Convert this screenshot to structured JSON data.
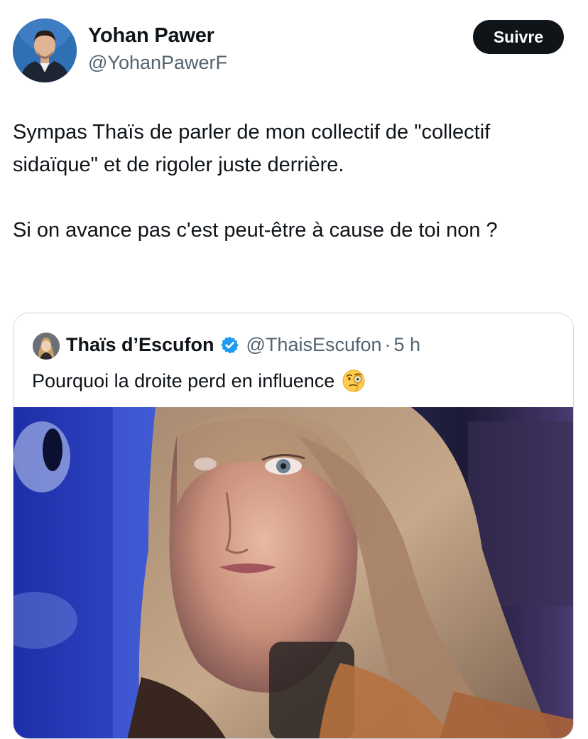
{
  "tweet": {
    "author": {
      "name": "Yohan Pawer",
      "handle": "@YohanPawerF"
    },
    "follow_label": "Suivre",
    "paragraphs": [
      "Sympas Thaïs de parler de mon collectif de \"collectif sidaïque\" et de rigoler juste derrière.",
      "Si on avance pas c'est peut-être à cause de toi non ?"
    ]
  },
  "quote": {
    "author": {
      "name": "Thaïs d’Escufon",
      "handle": "@ThaisEscufon",
      "separator": "·",
      "time": "5 h",
      "verified": true
    },
    "text": "Pourquoi la droite perd en influence",
    "emoji": "face-with-monocle-icon",
    "media": "video-still-woman-portrait"
  },
  "colors": {
    "text": "#0f1419",
    "secondary": "#536471",
    "verified": "#1d9bf0",
    "button": "#0f1419",
    "border": "#cfd9de"
  }
}
